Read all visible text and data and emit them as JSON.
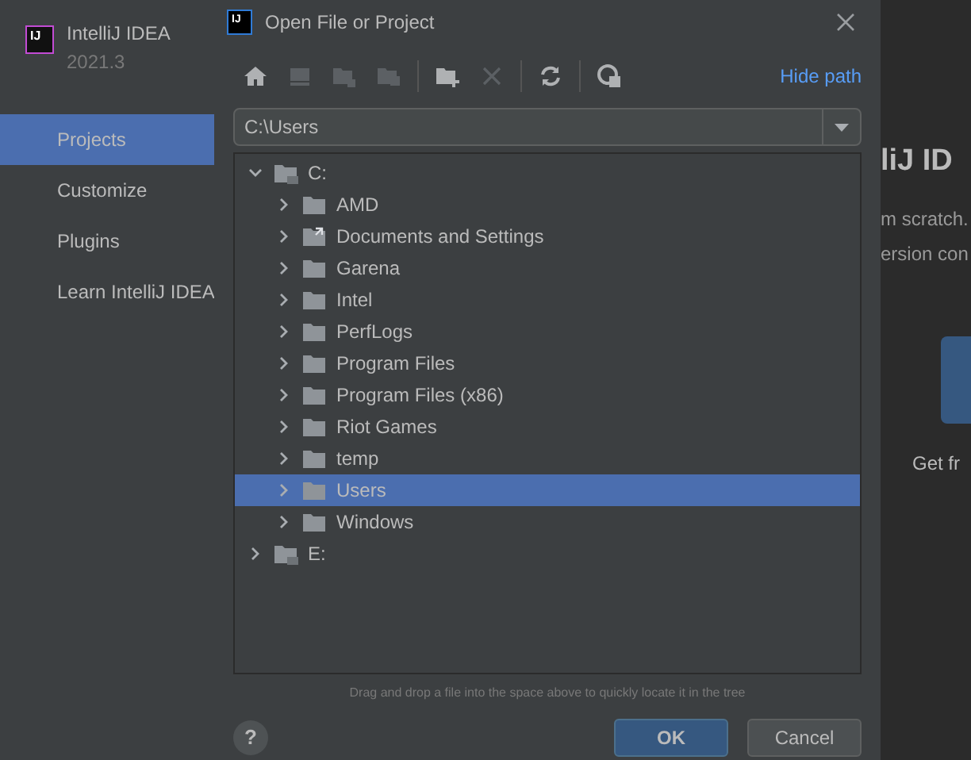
{
  "app": {
    "name": "IntelliJ IDEA",
    "version": "2021.3",
    "logo": "IJ"
  },
  "sidebar": {
    "items": [
      {
        "label": "Projects",
        "selected": true
      },
      {
        "label": "Customize",
        "selected": false
      },
      {
        "label": "Plugins",
        "selected": false
      },
      {
        "label": "Learn IntelliJ IDEA",
        "selected": false
      }
    ]
  },
  "welcome": {
    "title": "liJ ID",
    "lines": [
      "m scratch.",
      "ersion con"
    ],
    "caption": "Get fr"
  },
  "dialog": {
    "title": "Open File or Project",
    "logo": "IJ",
    "hide_path": "Hide path",
    "path": "C:\\Users",
    "toolbar": [
      {
        "kind": "home",
        "disabled": false
      },
      {
        "kind": "desktop",
        "disabled": true
      },
      {
        "kind": "project",
        "disabled": true
      },
      {
        "kind": "module",
        "disabled": true
      },
      {
        "kind": "sep"
      },
      {
        "kind": "new-folder",
        "disabled": false
      },
      {
        "kind": "delete",
        "disabled": true
      },
      {
        "kind": "sep"
      },
      {
        "kind": "refresh",
        "disabled": false
      },
      {
        "kind": "sep"
      },
      {
        "kind": "show-hidden",
        "disabled": false
      }
    ],
    "tree": [
      {
        "label": "C:",
        "kind": "drive",
        "expanded": true,
        "selected": false,
        "children": [
          {
            "label": "AMD",
            "kind": "folder",
            "expanded": false,
            "selected": false
          },
          {
            "label": "Documents and Settings",
            "kind": "link",
            "expanded": false,
            "selected": false
          },
          {
            "label": "Garena",
            "kind": "folder",
            "expanded": false,
            "selected": false
          },
          {
            "label": "Intel",
            "kind": "folder",
            "expanded": false,
            "selected": false
          },
          {
            "label": "PerfLogs",
            "kind": "folder",
            "expanded": false,
            "selected": false
          },
          {
            "label": "Program Files",
            "kind": "folder",
            "expanded": false,
            "selected": false
          },
          {
            "label": "Program Files (x86)",
            "kind": "folder",
            "expanded": false,
            "selected": false
          },
          {
            "label": "Riot Games",
            "kind": "folder",
            "expanded": false,
            "selected": false
          },
          {
            "label": "temp",
            "kind": "folder",
            "expanded": false,
            "selected": false
          },
          {
            "label": "Users",
            "kind": "folder",
            "expanded": false,
            "selected": true
          },
          {
            "label": "Windows",
            "kind": "folder",
            "expanded": false,
            "selected": false
          }
        ]
      },
      {
        "label": "E:",
        "kind": "drive",
        "expanded": false,
        "selected": false
      }
    ],
    "hint": "Drag and drop a file into the space above to quickly locate it in the tree",
    "help": "?",
    "ok": "OK",
    "cancel": "Cancel"
  }
}
